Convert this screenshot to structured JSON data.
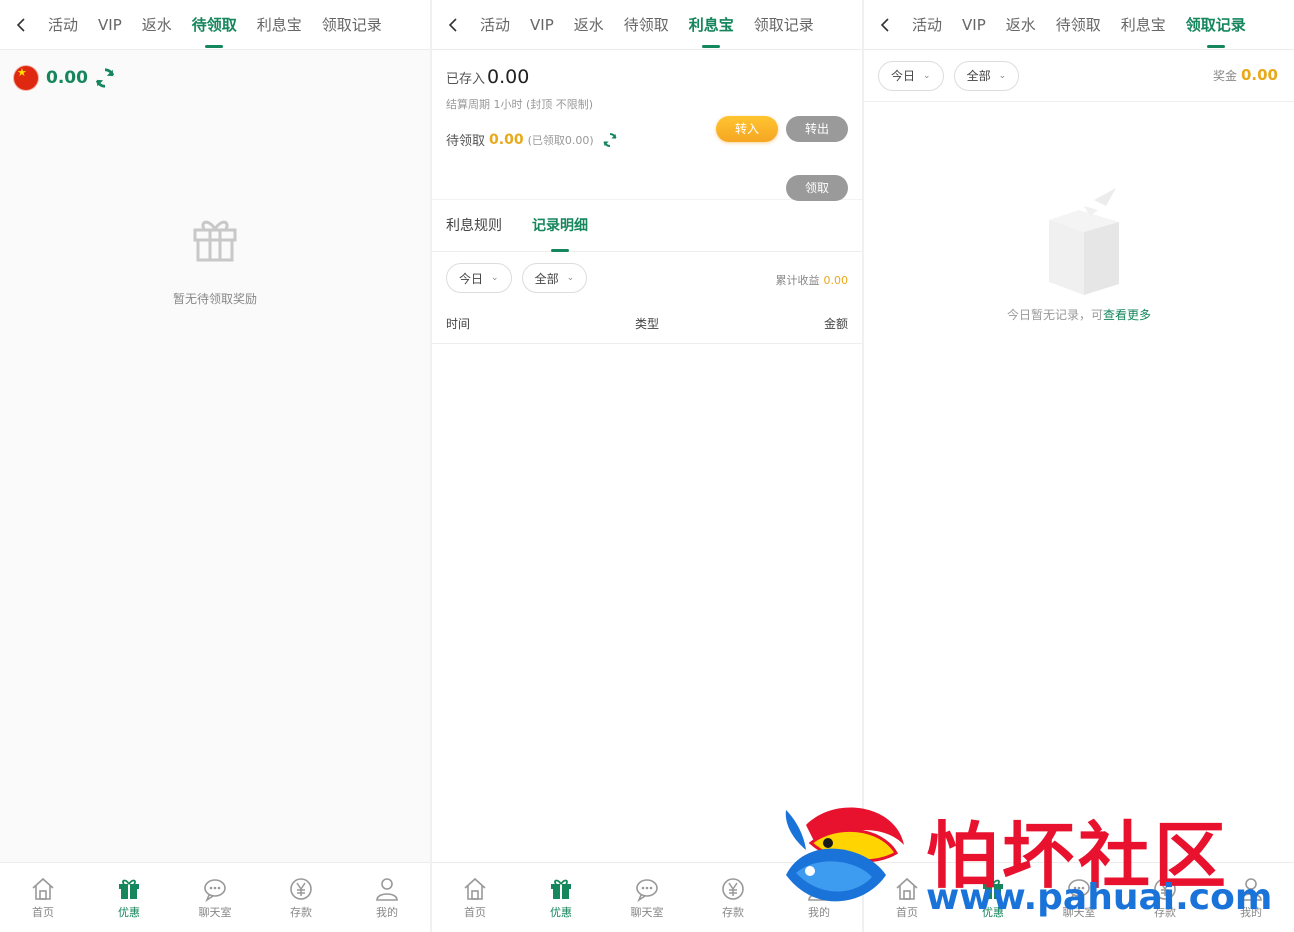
{
  "nav": {
    "back_icon": "chevron-left-icon",
    "tabs": [
      "活动",
      "VIP",
      "返水",
      "待领取",
      "利息宝",
      "领取记录"
    ]
  },
  "panel1": {
    "balance": "0.00",
    "empty_text": "暂无待领取奖励"
  },
  "panel2": {
    "stored_label": "已存入",
    "stored_value": "0.00",
    "period_text": "结算周期 1小时 (封顶 不限制)",
    "pending_label": "待领取",
    "pending_value": "0.00",
    "pending_claimed": "(已领取0.00)",
    "btn_in": "转入",
    "btn_out": "转出",
    "btn_claim": "领取",
    "subtabs": [
      "利息规则",
      "记录明细"
    ],
    "filter_day": "今日",
    "filter_type": "全部",
    "earn_label": "累计收益",
    "earn_value": "0.00",
    "col_time": "时间",
    "col_type": "类型",
    "col_amount": "金额"
  },
  "panel3": {
    "filter_day": "今日",
    "filter_type": "全部",
    "bonus_label": "奖金",
    "bonus_value": "0.00",
    "empty_text": "今日暂无记录，可",
    "empty_link": "查看更多"
  },
  "bottombar": {
    "items": [
      "首页",
      "优惠",
      "聊天室",
      "存款",
      "我的"
    ]
  },
  "watermark": {
    "title": "怕坏社区",
    "url": "www.pahuai.com"
  },
  "colors": {
    "accent": "#16865d",
    "gold": "#e8a91b",
    "watermark_red": "#e8112e",
    "watermark_blue": "#1a73d9"
  }
}
